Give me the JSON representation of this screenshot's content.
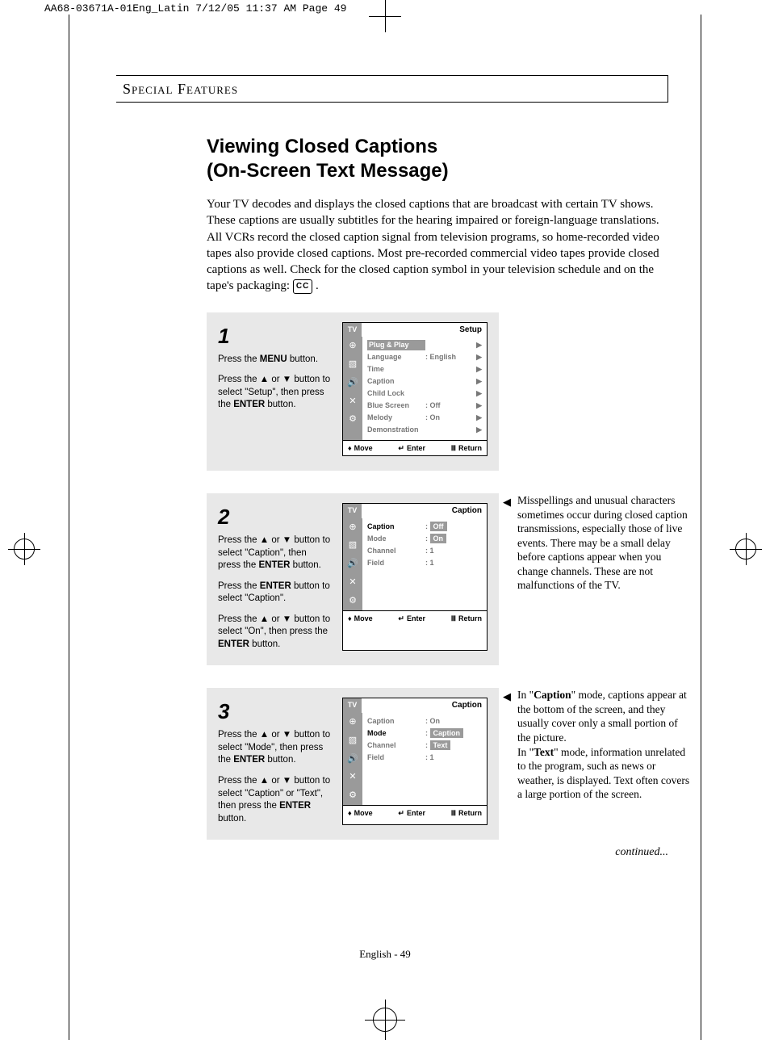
{
  "print_header": "AA68-03671A-01Eng_Latin  7/12/05  11:37 AM  Page 49",
  "section_header": "Special Features",
  "title_line1": "Viewing Closed Captions",
  "title_line2": "(On-Screen Text Message)",
  "intro": "Your TV decodes and displays the closed captions that are broadcast with certain TV shows. These captions are usually subtitles for the hearing impaired or foreign-language translations. All VCRs record the closed caption signal from television programs, so home-recorded video tapes also provide closed captions. Most pre-recorded commercial video tapes provide closed captions as well. Check for the closed caption symbol in your television schedule and on the tape's packaging: ",
  "cc_symbol": "CC",
  "steps": {
    "s1": {
      "num": "1",
      "p1a": "Press the ",
      "p1b": "MENU",
      "p1c": " button.",
      "p2a": "Press the ▲ or ▼ button to select \"Setup\", then press the ",
      "p2b": "ENTER",
      "p2c": " button."
    },
    "s2": {
      "num": "2",
      "p1a": "Press the ▲ or ▼ button to select \"Caption\", then press the ",
      "p1b": "ENTER",
      "p1c": " button.",
      "p2a": "Press the ",
      "p2b": "ENTER",
      "p2c": " button to select \"Caption\".",
      "p3a": "Press the ▲ or ▼ button to select \"On\", then press the ",
      "p3b": "ENTER",
      "p3c": " button."
    },
    "s3": {
      "num": "3",
      "p1a": "Press the ▲ or ▼ button to select \"Mode\", then press the ",
      "p1b": "ENTER",
      "p1c": " button.",
      "p2a": "Press the ▲ or ▼ button to select \"Caption\" or \"Text\", then press the ",
      "p2b": "ENTER",
      "p2c": " button."
    }
  },
  "osd1": {
    "tv": "TV",
    "title": "Setup",
    "rows": [
      {
        "lbl": "Plug & Play",
        "val": "",
        "hl": true,
        "arr": "▶"
      },
      {
        "lbl": "Language",
        "val": ":  English",
        "arr": "▶"
      },
      {
        "lbl": "Time",
        "val": "",
        "arr": "▶"
      },
      {
        "lbl": "Caption",
        "val": "",
        "arr": "▶"
      },
      {
        "lbl": "Child Lock",
        "val": "",
        "arr": "▶"
      },
      {
        "lbl": "Blue Screen",
        "val": ":  Off",
        "arr": "▶"
      },
      {
        "lbl": "Melody",
        "val": ":  On",
        "arr": "▶"
      },
      {
        "lbl": "Demonstration",
        "val": "",
        "arr": "▶"
      }
    ]
  },
  "osd2": {
    "tv": "TV",
    "title": "Caption",
    "rows": [
      {
        "lbl": "Caption",
        "val": ": ",
        "hlval": "Off",
        "bold": true
      },
      {
        "lbl": "Mode",
        "val": ": ",
        "hlval": "On"
      },
      {
        "lbl": "Channel",
        "val": ":  1"
      },
      {
        "lbl": "Field",
        "val": ":  1"
      }
    ]
  },
  "osd3": {
    "tv": "TV",
    "title": "Caption",
    "rows": [
      {
        "lbl": "Caption",
        "val": ":  On"
      },
      {
        "lbl": "Mode",
        "val": ": ",
        "hlval": "Caption",
        "bold": true
      },
      {
        "lbl": "Channel",
        "val": ": ",
        "hlval": "Text"
      },
      {
        "lbl": "Field",
        "val": ":  1"
      }
    ]
  },
  "osd_foot": {
    "move": "Move",
    "enter": "Enter",
    "return": "Return"
  },
  "note2a": "Misspellings and unusual characters sometimes occur during closed caption transmissions, especially those of live events. There may be a small delay before captions appear when you change channels. These are not malfunctions of the TV.",
  "note3a": "In \"",
  "note3b": "Caption",
  "note3c": "\" mode, captions appear at the bottom of the screen, and they usually cover only a small portion of the picture.",
  "note3d": "In \"",
  "note3e": "Text",
  "note3f": "\" mode, information unrelated to the program, such as news or weather, is displayed. Text often covers a large portion of the screen.",
  "continued": "continued...",
  "footer": "English - 49"
}
